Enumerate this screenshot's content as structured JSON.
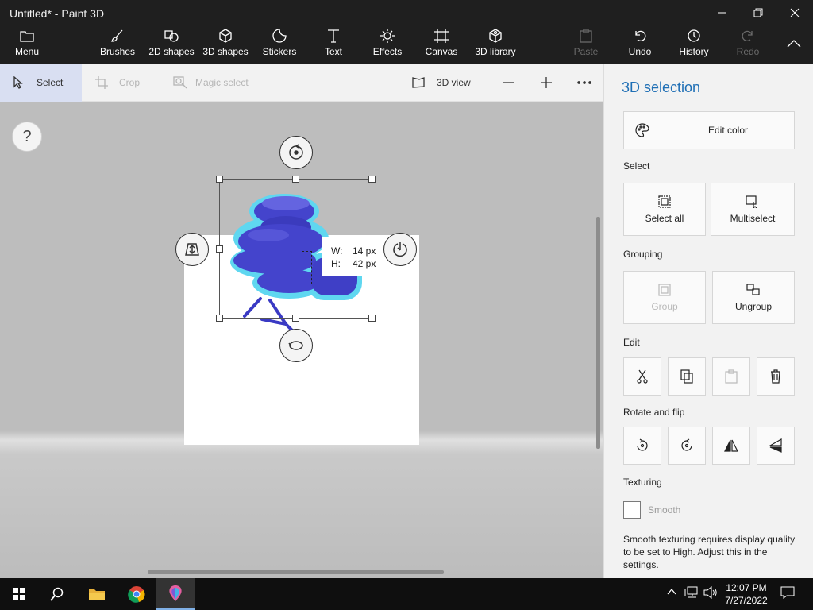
{
  "window": {
    "title": "Untitled* - Paint 3D"
  },
  "ribbon": {
    "menu": "Menu",
    "brushes": "Brushes",
    "shapes2d": "2D shapes",
    "shapes3d": "3D shapes",
    "stickers": "Stickers",
    "text": "Text",
    "effects": "Effects",
    "canvas": "Canvas",
    "library3d": "3D library",
    "paste": "Paste",
    "undo": "Undo",
    "history": "History",
    "redo": "Redo"
  },
  "toolbar": {
    "select": "Select",
    "crop": "Crop",
    "magic_select": "Magic select",
    "view3d": "3D view"
  },
  "canvas": {
    "help": "?",
    "dimensions": {
      "w_label": "W:",
      "w_value": "14 px",
      "h_label": "H:",
      "h_value": "42 px"
    }
  },
  "panel": {
    "title": "3D selection",
    "edit_color": "Edit color",
    "select_section": "Select",
    "select_all": "Select all",
    "multiselect": "Multiselect",
    "grouping_section": "Grouping",
    "group": "Group",
    "ungroup": "Ungroup",
    "edit_section": "Edit",
    "rotate_section": "Rotate and flip",
    "texturing_section": "Texturing",
    "smooth": "Smooth",
    "note": "Smooth texturing requires display quality to be set to High. Adjust this in the settings."
  },
  "taskbar": {
    "time": "12:07 PM",
    "date": "7/27/2022"
  },
  "colors": {
    "accent": "#1f6fb5",
    "model": "#4444cc",
    "glow": "#5fd7f0",
    "ribbon_bg": "#1f1f1f"
  }
}
